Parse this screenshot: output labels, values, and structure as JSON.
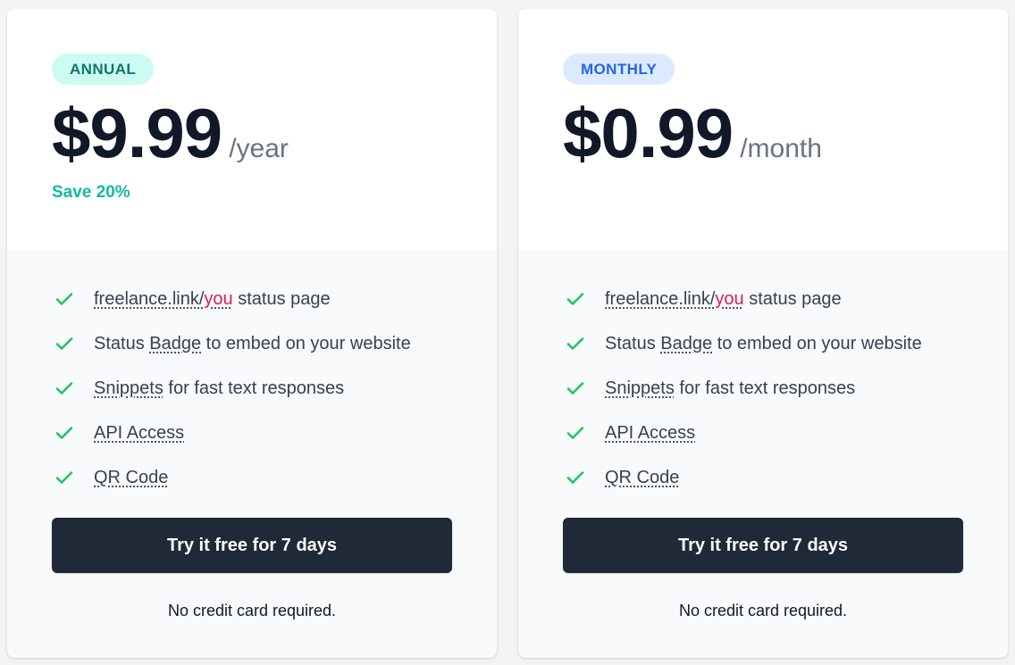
{
  "plans": [
    {
      "badge": "ANNUAL",
      "price": "$9.99",
      "period": "/year",
      "save": "Save 20%",
      "features": {
        "status_page": {
          "link_prefix": "freelance.link/",
          "link_highlight": "you",
          "suffix": " status page"
        },
        "badge": {
          "prefix": "Status ",
          "link": "Badge",
          "suffix": " to embed on your website"
        },
        "snippets": {
          "link": "Snippets",
          "suffix": " for fast text responses"
        },
        "api": {
          "link": "API Access"
        },
        "qr": {
          "link": "QR Code"
        }
      },
      "cta": "Try it free for 7 days",
      "note": "No credit card required."
    },
    {
      "badge": "MONTHLY",
      "price": "$0.99",
      "period": "/month",
      "save": "",
      "features": {
        "status_page": {
          "link_prefix": "freelance.link/",
          "link_highlight": "you",
          "suffix": " status page"
        },
        "badge": {
          "prefix": "Status ",
          "link": "Badge",
          "suffix": " to embed on your website"
        },
        "snippets": {
          "link": "Snippets",
          "suffix": " for fast text responses"
        },
        "api": {
          "link": "API Access"
        },
        "qr": {
          "link": "QR Code"
        }
      },
      "cta": "Try it free for 7 days",
      "note": "No credit card required."
    }
  ],
  "colors": {
    "check": "#22c55e",
    "annual_badge_bg": "#ccfbf1",
    "annual_badge_text": "#0f766e",
    "monthly_badge_bg": "#dbeafe",
    "monthly_badge_text": "#2563eb",
    "save_text": "#14b8a6",
    "highlight": "#e11d48",
    "button_bg": "#1f2937"
  },
  "icons": {
    "feature_check": "check-icon"
  }
}
